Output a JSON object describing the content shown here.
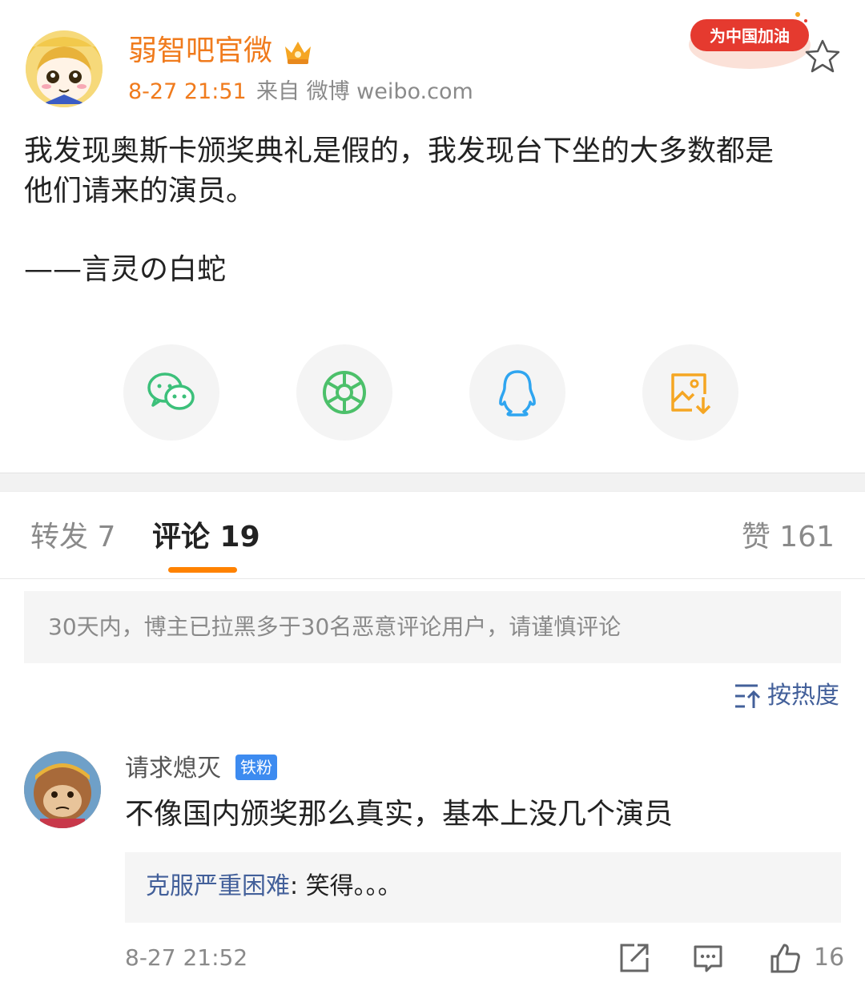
{
  "post": {
    "author": "弱智吧官微",
    "time": "8-27 21:51",
    "source": "来自 微博 weibo.com",
    "badge_text": "为中国加油",
    "body_line1": "我发现奥斯卡颁奖典礼是假的，我发现台下坐的大多数都是",
    "body_line2": "他们请来的演员。",
    "signature": "——言灵の白蛇",
    "icons": {
      "vip": "crown-badge-icon",
      "favorite": "star-icon",
      "share": [
        "wechat-icon",
        "moments-icon",
        "qq-icon",
        "save-image-icon"
      ]
    }
  },
  "tabs": {
    "repost": "转发 7",
    "comment": "评论 19",
    "like": "赞 161"
  },
  "notice": "30天内，博主已拉黑多于30名恶意评论用户，请谨慎评论",
  "sort_label": "按热度",
  "comment": {
    "user": "请求熄灭",
    "fan_badge": "铁粉",
    "text": "不像国内颁奖那么真实，基本上没几个演员",
    "reply_user": "克服严重困难",
    "reply_text": ": 笑得。。。",
    "time": "8-27 21:52",
    "like_count": "16"
  },
  "colors": {
    "accent_orange": "#ff8200",
    "author_orange": "#f07b1d",
    "link_blue": "#43609a",
    "fan_blue": "#3d8bf0"
  }
}
